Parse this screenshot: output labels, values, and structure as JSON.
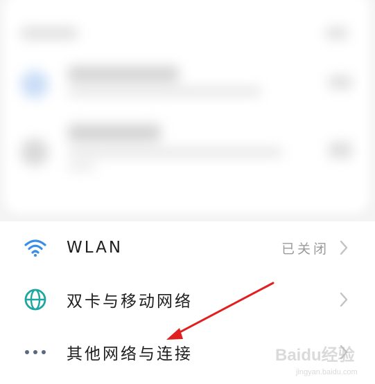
{
  "settings": {
    "items": [
      {
        "label": "WLAN",
        "status": "已关闭",
        "icon": "wifi-icon"
      },
      {
        "label": "双卡与移动网络",
        "status": "",
        "icon": "globe-icon"
      },
      {
        "label": "其他网络与连接",
        "status": "",
        "icon": "more-dots-icon"
      }
    ]
  },
  "watermark": {
    "brand": "Baidu经验",
    "url": "jingyan.baidu.com"
  },
  "colors": {
    "accent_blue": "#3b8ee6",
    "globe_teal": "#1fa6a0",
    "dots_gray": "#5a6a7e",
    "annotation_red": "#e02020",
    "chevron_gray": "#c2c2c2"
  }
}
